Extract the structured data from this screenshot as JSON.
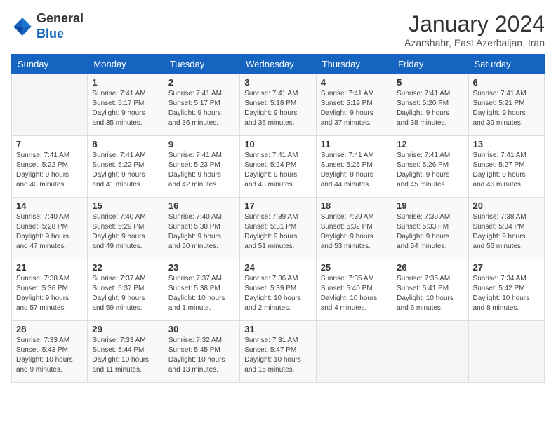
{
  "logo": {
    "general": "General",
    "blue": "Blue"
  },
  "header": {
    "month": "January 2024",
    "location": "Azarshahr, East Azerbaijan, Iran"
  },
  "days_of_week": [
    "Sunday",
    "Monday",
    "Tuesday",
    "Wednesday",
    "Thursday",
    "Friday",
    "Saturday"
  ],
  "weeks": [
    [
      {
        "day": "",
        "info": ""
      },
      {
        "day": "1",
        "info": "Sunrise: 7:41 AM\nSunset: 5:17 PM\nDaylight: 9 hours\nand 35 minutes."
      },
      {
        "day": "2",
        "info": "Sunrise: 7:41 AM\nSunset: 5:17 PM\nDaylight: 9 hours\nand 36 minutes."
      },
      {
        "day": "3",
        "info": "Sunrise: 7:41 AM\nSunset: 5:18 PM\nDaylight: 9 hours\nand 36 minutes."
      },
      {
        "day": "4",
        "info": "Sunrise: 7:41 AM\nSunset: 5:19 PM\nDaylight: 9 hours\nand 37 minutes."
      },
      {
        "day": "5",
        "info": "Sunrise: 7:41 AM\nSunset: 5:20 PM\nDaylight: 9 hours\nand 38 minutes."
      },
      {
        "day": "6",
        "info": "Sunrise: 7:41 AM\nSunset: 5:21 PM\nDaylight: 9 hours\nand 39 minutes."
      }
    ],
    [
      {
        "day": "7",
        "info": "Sunrise: 7:41 AM\nSunset: 5:22 PM\nDaylight: 9 hours\nand 40 minutes."
      },
      {
        "day": "8",
        "info": "Sunrise: 7:41 AM\nSunset: 5:22 PM\nDaylight: 9 hours\nand 41 minutes."
      },
      {
        "day": "9",
        "info": "Sunrise: 7:41 AM\nSunset: 5:23 PM\nDaylight: 9 hours\nand 42 minutes."
      },
      {
        "day": "10",
        "info": "Sunrise: 7:41 AM\nSunset: 5:24 PM\nDaylight: 9 hours\nand 43 minutes."
      },
      {
        "day": "11",
        "info": "Sunrise: 7:41 AM\nSunset: 5:25 PM\nDaylight: 9 hours\nand 44 minutes."
      },
      {
        "day": "12",
        "info": "Sunrise: 7:41 AM\nSunset: 5:26 PM\nDaylight: 9 hours\nand 45 minutes."
      },
      {
        "day": "13",
        "info": "Sunrise: 7:41 AM\nSunset: 5:27 PM\nDaylight: 9 hours\nand 46 minutes."
      }
    ],
    [
      {
        "day": "14",
        "info": "Sunrise: 7:40 AM\nSunset: 5:28 PM\nDaylight: 9 hours\nand 47 minutes."
      },
      {
        "day": "15",
        "info": "Sunrise: 7:40 AM\nSunset: 5:29 PM\nDaylight: 9 hours\nand 49 minutes."
      },
      {
        "day": "16",
        "info": "Sunrise: 7:40 AM\nSunset: 5:30 PM\nDaylight: 9 hours\nand 50 minutes."
      },
      {
        "day": "17",
        "info": "Sunrise: 7:39 AM\nSunset: 5:31 PM\nDaylight: 9 hours\nand 51 minutes."
      },
      {
        "day": "18",
        "info": "Sunrise: 7:39 AM\nSunset: 5:32 PM\nDaylight: 9 hours\nand 53 minutes."
      },
      {
        "day": "19",
        "info": "Sunrise: 7:39 AM\nSunset: 5:33 PM\nDaylight: 9 hours\nand 54 minutes."
      },
      {
        "day": "20",
        "info": "Sunrise: 7:38 AM\nSunset: 5:34 PM\nDaylight: 9 hours\nand 56 minutes."
      }
    ],
    [
      {
        "day": "21",
        "info": "Sunrise: 7:38 AM\nSunset: 5:36 PM\nDaylight: 9 hours\nand 57 minutes."
      },
      {
        "day": "22",
        "info": "Sunrise: 7:37 AM\nSunset: 5:37 PM\nDaylight: 9 hours\nand 59 minutes."
      },
      {
        "day": "23",
        "info": "Sunrise: 7:37 AM\nSunset: 5:38 PM\nDaylight: 10 hours\nand 1 minute."
      },
      {
        "day": "24",
        "info": "Sunrise: 7:36 AM\nSunset: 5:39 PM\nDaylight: 10 hours\nand 2 minutes."
      },
      {
        "day": "25",
        "info": "Sunrise: 7:35 AM\nSunset: 5:40 PM\nDaylight: 10 hours\nand 4 minutes."
      },
      {
        "day": "26",
        "info": "Sunrise: 7:35 AM\nSunset: 5:41 PM\nDaylight: 10 hours\nand 6 minutes."
      },
      {
        "day": "27",
        "info": "Sunrise: 7:34 AM\nSunset: 5:42 PM\nDaylight: 10 hours\nand 8 minutes."
      }
    ],
    [
      {
        "day": "28",
        "info": "Sunrise: 7:33 AM\nSunset: 5:43 PM\nDaylight: 10 hours\nand 9 minutes."
      },
      {
        "day": "29",
        "info": "Sunrise: 7:33 AM\nSunset: 5:44 PM\nDaylight: 10 hours\nand 11 minutes."
      },
      {
        "day": "30",
        "info": "Sunrise: 7:32 AM\nSunset: 5:45 PM\nDaylight: 10 hours\nand 13 minutes."
      },
      {
        "day": "31",
        "info": "Sunrise: 7:31 AM\nSunset: 5:47 PM\nDaylight: 10 hours\nand 15 minutes."
      },
      {
        "day": "",
        "info": ""
      },
      {
        "day": "",
        "info": ""
      },
      {
        "day": "",
        "info": ""
      }
    ]
  ]
}
